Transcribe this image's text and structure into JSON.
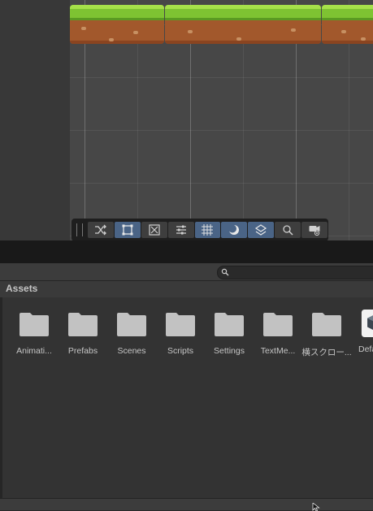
{
  "toolbar": {
    "buttons": [
      {
        "name": "shuffle-icon",
        "active": false
      },
      {
        "name": "rect-tool-icon",
        "active": true
      },
      {
        "name": "transform-icon",
        "active": false
      },
      {
        "name": "sliders-icon",
        "active": false
      },
      {
        "name": "grid-snap-icon",
        "active": true
      },
      {
        "name": "moon-icon",
        "active": true
      },
      {
        "name": "layers-icon",
        "active": true
      },
      {
        "name": "search-icon",
        "active": false
      },
      {
        "name": "camera-eye-icon",
        "active": false
      }
    ]
  },
  "project": {
    "search_placeholder": "",
    "breadcrumb": "Assets"
  },
  "assets": [
    {
      "label": "Animati...",
      "type": "folder"
    },
    {
      "label": "Prefabs",
      "type": "folder"
    },
    {
      "label": "Scenes",
      "type": "folder"
    },
    {
      "label": "Scripts",
      "type": "folder"
    },
    {
      "label": "Settings",
      "type": "folder"
    },
    {
      "label": "TextMe...",
      "type": "folder"
    },
    {
      "label": "横スクロー...",
      "type": "folder"
    },
    {
      "label": "Defa",
      "type": "asset-cube"
    }
  ],
  "colors": {
    "accent": "#4a6486",
    "grass": "#7ec332",
    "dirt": "#a2582c",
    "folder": "#c2c2c2"
  }
}
